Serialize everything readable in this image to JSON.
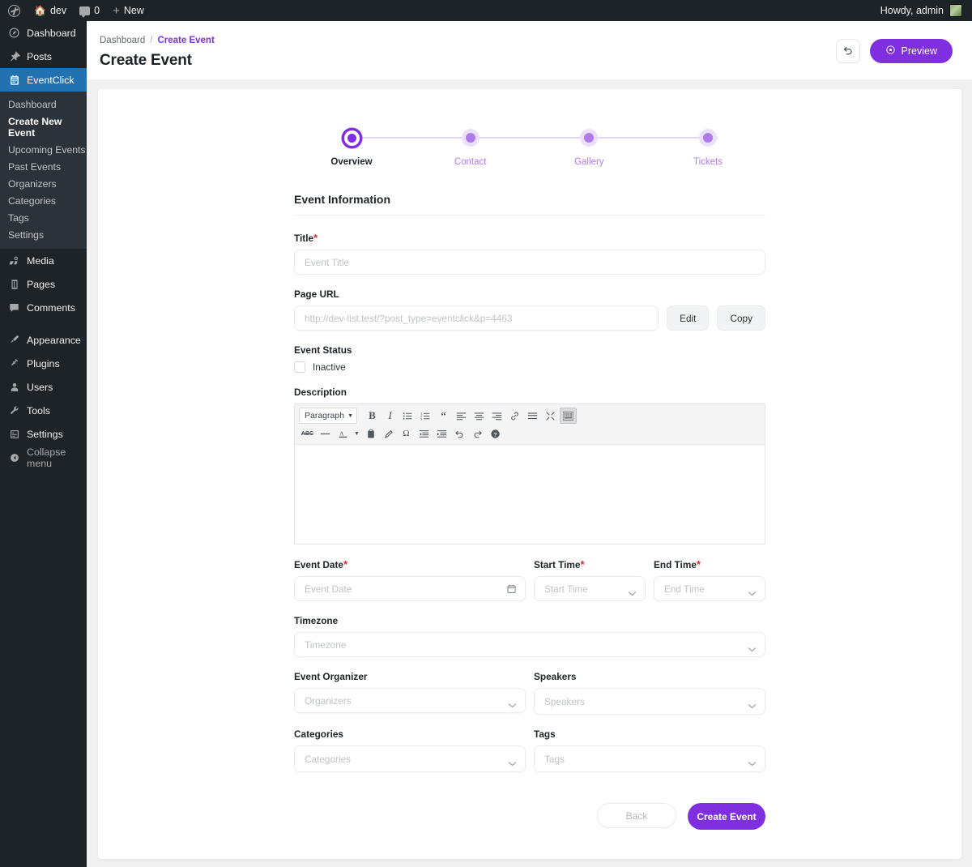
{
  "adminbar": {
    "logo_icon": "wordpress-logo-icon",
    "site_icon": "home-icon",
    "site_name": "dev",
    "comments_icon": "comment-bubble-icon",
    "comments_count": "0",
    "new_icon": "plus-icon",
    "new_label": "New",
    "howdy": "Howdy, admin",
    "avatar_icon": "avatar-image"
  },
  "sidebar": {
    "items": [
      {
        "label": "Dashboard",
        "icon": "dashboard-icon"
      },
      {
        "label": "Posts",
        "icon": "pin-icon"
      },
      {
        "label": "EventClick",
        "icon": "calendar-icon",
        "active": true
      },
      {
        "label": "Media",
        "icon": "media-icon"
      },
      {
        "label": "Pages",
        "icon": "page-icon"
      },
      {
        "label": "Comments",
        "icon": "comment-bubble-icon"
      },
      {
        "label": "Appearance",
        "icon": "paintbrush-icon"
      },
      {
        "label": "Plugins",
        "icon": "plug-icon"
      },
      {
        "label": "Users",
        "icon": "user-icon"
      },
      {
        "label": "Tools",
        "icon": "wrench-icon"
      },
      {
        "label": "Settings",
        "icon": "sliders-icon"
      },
      {
        "label": "Collapse menu",
        "icon": "collapse-icon"
      }
    ],
    "submenu": [
      {
        "label": "Dashboard"
      },
      {
        "label": "Create New Event",
        "current": true
      },
      {
        "label": "Upcoming Events"
      },
      {
        "label": "Past Events"
      },
      {
        "label": "Organizers"
      },
      {
        "label": "Categories"
      },
      {
        "label": "Tags"
      },
      {
        "label": "Settings"
      }
    ]
  },
  "header": {
    "breadcrumb_root": "Dashboard",
    "breadcrumb_sep": "/",
    "breadcrumb_current": "Create Event",
    "title": "Create Event",
    "undo_icon": "undo-arrow-icon",
    "preview_icon": "eye-icon",
    "preview_label": "Preview"
  },
  "stepper": {
    "steps": [
      {
        "label": "Overview",
        "state": "active"
      },
      {
        "label": "Contact",
        "state": "idle"
      },
      {
        "label": "Gallery",
        "state": "idle"
      },
      {
        "label": "Tickets",
        "state": "idle"
      }
    ]
  },
  "form": {
    "section_title": "Event Information",
    "title": {
      "label": "Title",
      "required": "*",
      "placeholder": "Event Title",
      "value": ""
    },
    "page_url": {
      "label": "Page URL",
      "placeholder": "http://dev-list.test/?post_type=eventclick&p=4463",
      "value": "",
      "edit_label": "Edit",
      "copy_label": "Copy"
    },
    "event_status": {
      "label": "Event Status",
      "checkbox_label": "Inactive",
      "checked": false
    },
    "description": {
      "label": "Description",
      "format_select": "Paragraph",
      "toolbar_row1": [
        "bold-icon",
        "italic-icon",
        "bulleted-list-icon",
        "numbered-list-icon",
        "blockquote-icon",
        "align-left-icon",
        "align-center-icon",
        "align-right-icon",
        "link-icon",
        "insert-more-icon",
        "distraction-free-icon",
        "toolbar-toggle-icon"
      ],
      "toolbar_row2": [
        "strikethrough-icon",
        "horizontal-rule-icon",
        "text-color-icon",
        "color-dropdown-icon",
        "paste-as-text-icon",
        "clear-formatting-icon",
        "special-character-icon",
        "outdent-icon",
        "indent-icon",
        "undo-icon",
        "redo-icon",
        "help-icon"
      ],
      "content": ""
    },
    "event_date": {
      "label": "Event Date",
      "required": "*",
      "placeholder": "Event Date",
      "value": "",
      "icon": "calendar-icon"
    },
    "start_time": {
      "label": "Start Time",
      "required": "*",
      "placeholder": "Start Time",
      "value": "",
      "icon": "chevron-down-icon"
    },
    "end_time": {
      "label": "End Time",
      "required": "*",
      "placeholder": "End Time",
      "value": "",
      "icon": "chevron-down-icon"
    },
    "timezone": {
      "label": "Timezone",
      "placeholder": "Timezone",
      "value": "",
      "icon": "chevron-down-icon"
    },
    "event_organizer": {
      "label": "Event Organizer",
      "placeholder": "Organizers",
      "value": "",
      "icon": "chevron-down-icon"
    },
    "speakers": {
      "label": "Speakers",
      "placeholder": "Speakers",
      "value": "",
      "icon": "chevron-down-icon"
    },
    "categories": {
      "label": "Categories",
      "placeholder": "Categories",
      "value": "",
      "icon": "chevron-down-icon"
    },
    "tags": {
      "label": "Tags",
      "placeholder": "Tags",
      "value": "",
      "icon": "chevron-down-icon"
    },
    "back_label": "Back",
    "submit_label": "Create Event"
  },
  "colors": {
    "accent_purple": "#7f2fdf",
    "step_idle": "#b07be8",
    "step_halo": "#ecdffa",
    "wp_admin_blue": "#2271b1",
    "wp_dark": "#1d2327",
    "required_red": "#e02b2b",
    "page_bg": "#f0f0f1"
  }
}
